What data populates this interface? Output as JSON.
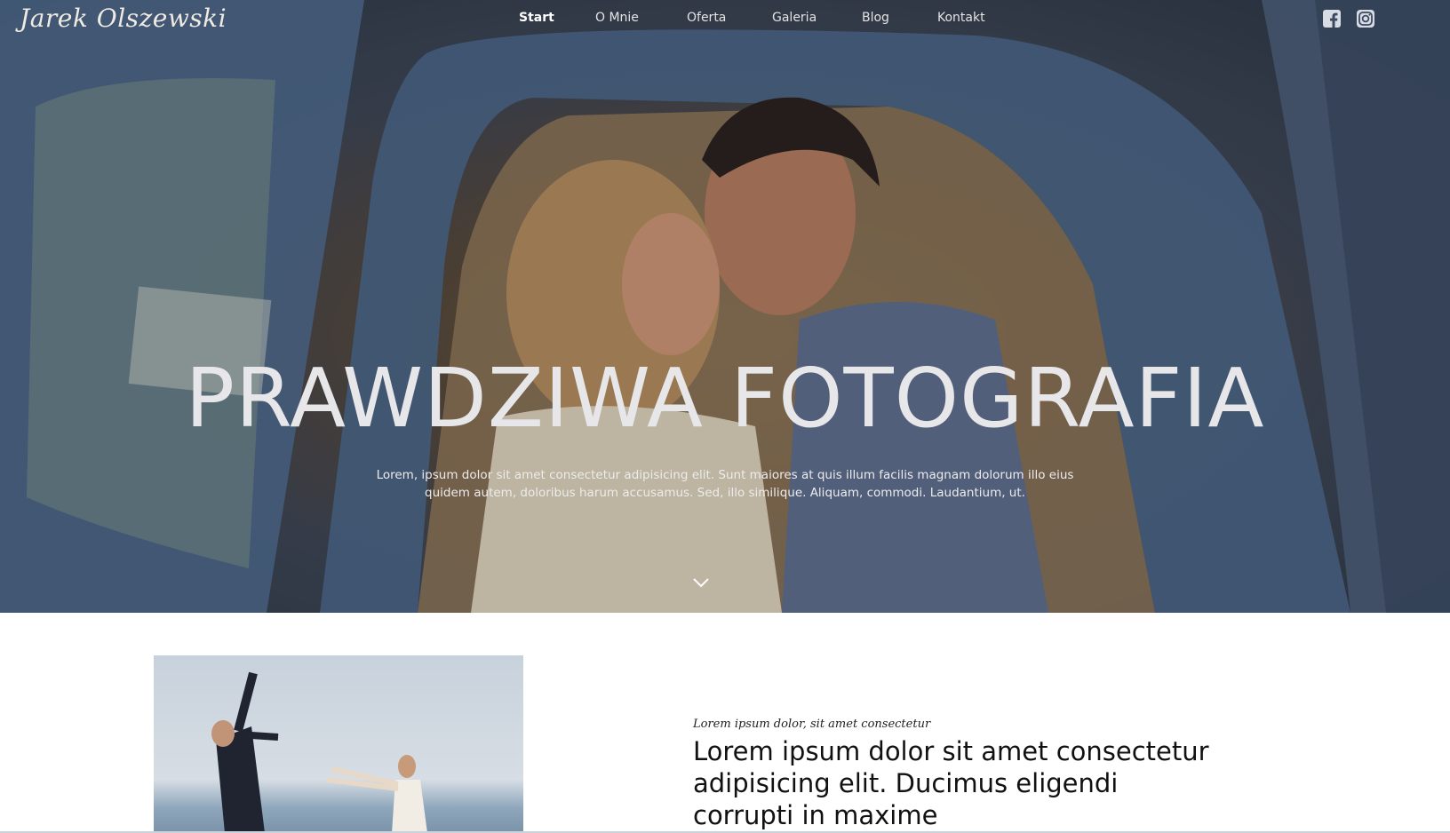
{
  "header": {
    "logo": "Jarek Olszewski",
    "nav": [
      {
        "label": "Start",
        "active": true
      },
      {
        "label": "O Mnie",
        "active": false
      },
      {
        "label": "Oferta",
        "active": false
      },
      {
        "label": "Galeria",
        "active": false
      },
      {
        "label": "Blog",
        "active": false
      },
      {
        "label": "Kontakt",
        "active": false
      }
    ],
    "social_icons": [
      "facebook-icon",
      "instagram-icon"
    ]
  },
  "hero": {
    "title": "PRAWDZIWA FOTOGRAFIA",
    "text": "Lorem, ipsum dolor sit amet consectetur adipisicing elit. Sunt maiores at quis illum facilis magnam dolorum illo eius quidem autem, doloribus harum accusamus. Sed, illo similique. Aliquam, commodi. Laudantium, ut.",
    "scroll_icon": "chevron-down-icon"
  },
  "about": {
    "kicker": "Lorem ipsum dolor, sit amet consectetur",
    "heading": "Lorem ipsum dolor sit amet consectetur adipisicing elit. Ducimus eligendi corrupti in maxime"
  },
  "colors": {
    "nav_text": "#e3e3e3",
    "hero_title": "#e7e7ea",
    "heading_text": "#111111"
  }
}
